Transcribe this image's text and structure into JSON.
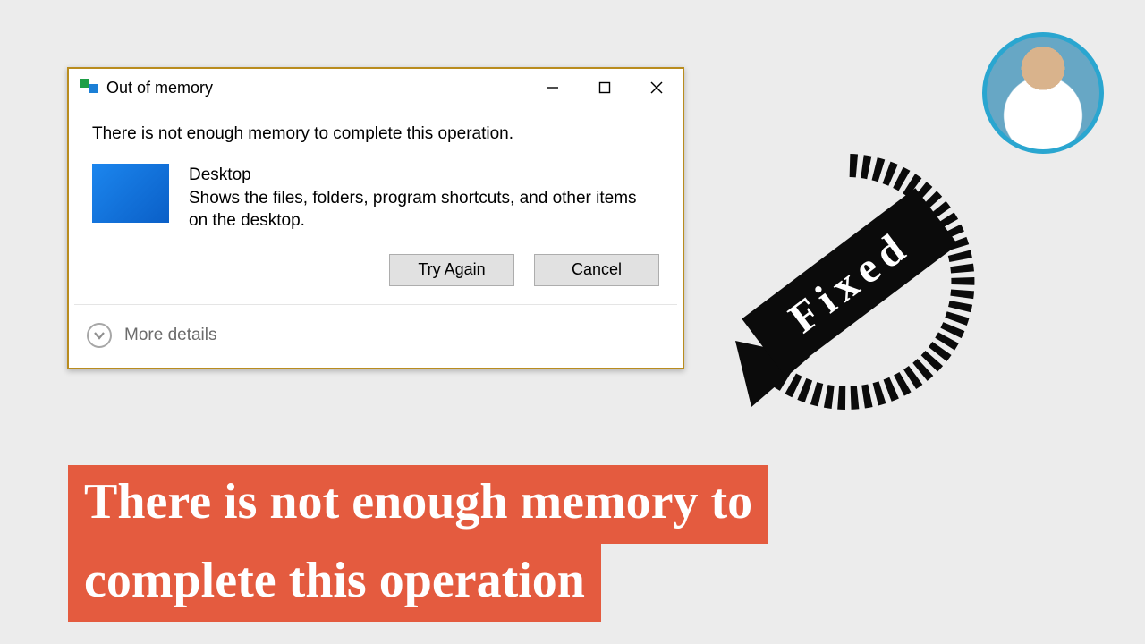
{
  "dialog": {
    "title": "Out of memory",
    "message": "There is not enough memory to complete this operation.",
    "item_name": "Desktop",
    "item_desc": "Shows the files, folders, program shortcuts, and other items on the desktop.",
    "try_again_label": "Try Again",
    "cancel_label": "Cancel",
    "more_details_label": "More details"
  },
  "badge": {
    "text": "Fixed"
  },
  "headline": {
    "line1": "There is not enough memory to",
    "line2": "complete this operation"
  }
}
